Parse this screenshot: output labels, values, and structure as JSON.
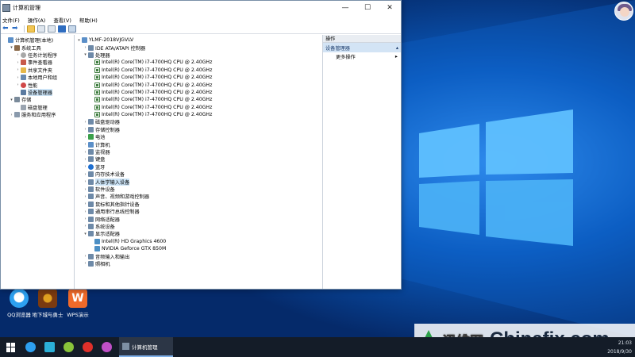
{
  "window": {
    "title": "计算机管理",
    "controls": {
      "minimize": "—",
      "maximize": "☐",
      "close": "✕"
    }
  },
  "menu": [
    "文件(F)",
    "操作(A)",
    "查看(V)",
    "帮助(H)"
  ],
  "left_tree": [
    {
      "label": "计算机管理(本地)",
      "icon": "computer-icon",
      "exp": "",
      "indent": 0
    },
    {
      "label": "系统工具",
      "icon": "tools-icon",
      "exp": "▾",
      "indent": 1
    },
    {
      "label": "任务计划程序",
      "icon": "clock-icon",
      "exp": "›",
      "indent": 2
    },
    {
      "label": "事件查看器",
      "icon": "event-viewer-icon",
      "exp": "›",
      "indent": 2
    },
    {
      "label": "共享文件夹",
      "icon": "shared-folder-icon",
      "exp": "›",
      "indent": 2
    },
    {
      "label": "本地用户和组",
      "icon": "users-icon",
      "exp": "›",
      "indent": 2
    },
    {
      "label": "性能",
      "icon": "performance-icon",
      "exp": "›",
      "indent": 2
    },
    {
      "label": "设备管理器",
      "icon": "device-manager-icon",
      "exp": "",
      "indent": 2,
      "selected": true
    },
    {
      "label": "存储",
      "icon": "storage-icon",
      "exp": "▾",
      "indent": 1
    },
    {
      "label": "磁盘管理",
      "icon": "disk-icon",
      "exp": "",
      "indent": 2
    },
    {
      "label": "服务和应用程序",
      "icon": "services-icon",
      "exp": "›",
      "indent": 1
    }
  ],
  "device_tree": [
    {
      "label": "YLMF-2018VJGVLV",
      "icon": "computer-icon",
      "exp": "▾",
      "indent": 0
    },
    {
      "label": "IDE ATA/ATAPI 控制器",
      "icon": "ide-controller-icon",
      "exp": "›",
      "indent": 1
    },
    {
      "label": "处理器",
      "icon": "processor-icon",
      "exp": "▾",
      "indent": 1
    },
    {
      "label": "Intel(R) Core(TM) i7-4700HQ CPU @ 2.40GHz",
      "icon": "cpu-icon",
      "exp": "",
      "indent": 2
    },
    {
      "label": "Intel(R) Core(TM) i7-4700HQ CPU @ 2.40GHz",
      "icon": "cpu-icon",
      "exp": "",
      "indent": 2
    },
    {
      "label": "Intel(R) Core(TM) i7-4700HQ CPU @ 2.40GHz",
      "icon": "cpu-icon",
      "exp": "",
      "indent": 2
    },
    {
      "label": "Intel(R) Core(TM) i7-4700HQ CPU @ 2.40GHz",
      "icon": "cpu-icon",
      "exp": "",
      "indent": 2
    },
    {
      "label": "Intel(R) Core(TM) i7-4700HQ CPU @ 2.40GHz",
      "icon": "cpu-icon",
      "exp": "",
      "indent": 2
    },
    {
      "label": "Intel(R) Core(TM) i7-4700HQ CPU @ 2.40GHz",
      "icon": "cpu-icon",
      "exp": "",
      "indent": 2
    },
    {
      "label": "Intel(R) Core(TM) i7-4700HQ CPU @ 2.40GHz",
      "icon": "cpu-icon",
      "exp": "",
      "indent": 2
    },
    {
      "label": "Intel(R) Core(TM) i7-4700HQ CPU @ 2.40GHz",
      "icon": "cpu-icon",
      "exp": "",
      "indent": 2
    },
    {
      "label": "磁盘驱动器",
      "icon": "disk-drive-icon",
      "exp": "›",
      "indent": 1
    },
    {
      "label": "存储控制器",
      "icon": "storage-controller-icon",
      "exp": "›",
      "indent": 1
    },
    {
      "label": "电池",
      "icon": "battery-icon",
      "exp": "›",
      "indent": 1
    },
    {
      "label": "计算机",
      "icon": "computer-icon",
      "exp": "›",
      "indent": 1
    },
    {
      "label": "监视器",
      "icon": "monitor-icon",
      "exp": "›",
      "indent": 1
    },
    {
      "label": "键盘",
      "icon": "keyboard-icon",
      "exp": "›",
      "indent": 1
    },
    {
      "label": "蓝牙",
      "icon": "bluetooth-icon",
      "exp": "›",
      "indent": 1
    },
    {
      "label": "内存技术设备",
      "icon": "memory-device-icon",
      "exp": "›",
      "indent": 1
    },
    {
      "label": "人体学输入设备",
      "icon": "hid-icon",
      "exp": "›",
      "indent": 1,
      "selected": true
    },
    {
      "label": "软件设备",
      "icon": "software-device-icon",
      "exp": "›",
      "indent": 1
    },
    {
      "label": "声音、视频和游戏控制器",
      "icon": "sound-icon",
      "exp": "›",
      "indent": 1
    },
    {
      "label": "鼠标和其他指针设备",
      "icon": "mouse-icon",
      "exp": "›",
      "indent": 1
    },
    {
      "label": "通用串行总线控制器",
      "icon": "usb-icon",
      "exp": "›",
      "indent": 1
    },
    {
      "label": "网络适配器",
      "icon": "network-adapter-icon",
      "exp": "›",
      "indent": 1
    },
    {
      "label": "系统设备",
      "icon": "system-device-icon",
      "exp": "›",
      "indent": 1
    },
    {
      "label": "显示适配器",
      "icon": "display-adapter-icon",
      "exp": "▾",
      "indent": 1
    },
    {
      "label": "Intel(R) HD Graphics 4600",
      "icon": "gpu-icon",
      "exp": "",
      "indent": 2
    },
    {
      "label": "NVIDIA Geforce GTX 850M",
      "icon": "gpu-icon",
      "exp": "",
      "indent": 2
    },
    {
      "label": "音频输入和输出",
      "icon": "audio-io-icon",
      "exp": "›",
      "indent": 1
    },
    {
      "label": "照相机",
      "icon": "camera-icon",
      "exp": "›",
      "indent": 1
    }
  ],
  "actions": {
    "header": "操作",
    "section_title": "设备管理器",
    "more": "更多操作"
  },
  "desktop_icons": [
    {
      "label": "QQ浏览器",
      "icon": "qq-browser-icon"
    },
    {
      "label": "地下城与勇士",
      "icon": "dnf-game-icon"
    },
    {
      "label": "WPS演示",
      "icon": "wps-icon"
    }
  ],
  "taskbar": {
    "active_task": "计算机管理",
    "time": "21:03",
    "date": "2018/9/30"
  },
  "watermark": {
    "cn": "迅维网",
    "en": "Chinafix.com"
  }
}
